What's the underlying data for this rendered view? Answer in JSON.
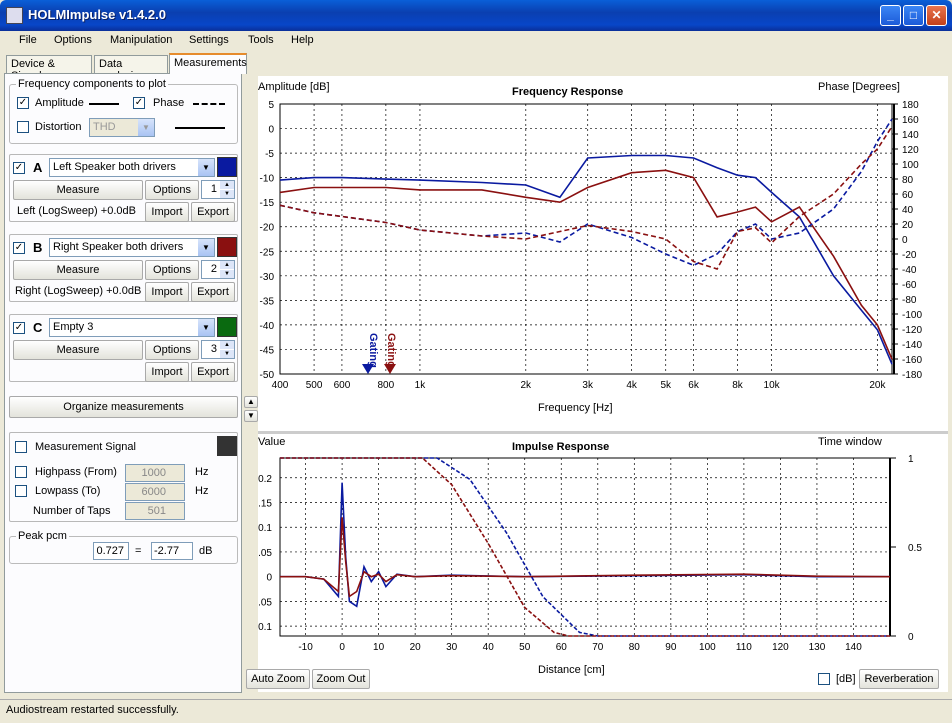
{
  "window": {
    "title": "HOLMImpulse  v1.4.2.0",
    "minimize": "_",
    "maximize": "□",
    "close": "✕"
  },
  "menu": [
    "File",
    "Options",
    "Manipulation",
    "Settings",
    "Tools",
    "Help"
  ],
  "tabs": [
    "Device & Signal",
    "Data analysis",
    "Measurements"
  ],
  "freq_group": {
    "legend": "Frequency components to plot",
    "amplitude": "Amplitude",
    "phase": "Phase",
    "distortion": "Distortion",
    "distortion_select": "THD"
  },
  "measurements": [
    {
      "letter": "A",
      "name": "Left Speaker both drivers",
      "color": "#0a1aa0",
      "measure": "Measure",
      "options": "Options",
      "number": "1",
      "info": "Left (LogSweep) +0.0dB",
      "import": "Import",
      "export": "Export"
    },
    {
      "letter": "B",
      "name": "Right Speaker both drivers",
      "color": "#8a1010",
      "measure": "Measure",
      "options": "Options",
      "number": "2",
      "info": "Right (LogSweep) +0.0dB",
      "import": "Import",
      "export": "Export"
    },
    {
      "letter": "C",
      "name": "Empty 3",
      "color": "#0a6a10",
      "measure": "Measure",
      "options": "Options",
      "number": "3",
      "info": "",
      "import": "Import",
      "export": "Export"
    }
  ],
  "organize": "Organize measurements",
  "signal": {
    "label": "Measurement Signal",
    "highpass": "Highpass (From)",
    "highpass_val": "1000",
    "lowpass": "Lowpass (To)",
    "lowpass_val": "6000",
    "hz": "Hz",
    "taps": "Number of Taps",
    "taps_val": "501"
  },
  "peak": {
    "legend": "Peak pcm",
    "value": "0.727",
    "eq": "=",
    "db": "-2.77",
    "unit": "dB"
  },
  "freq_chart": {
    "title": "Frequency Response",
    "left_label": "Amplitude [dB]",
    "right_label": "Phase [Degrees]",
    "xlabel": "Frequency [Hz]",
    "gating_a": "Gating",
    "gating_b": "Gating",
    "y_ticks": [
      "5",
      "0",
      "-5",
      "-10",
      "-15",
      "-20",
      "-25",
      "-30",
      "-35",
      "-40",
      "-45",
      "-50"
    ],
    "phase_ticks": [
      "180",
      "160",
      "140",
      "120",
      "100",
      "80",
      "60",
      "40",
      "20",
      "0",
      "-20",
      "-40",
      "-60",
      "-80",
      "-100",
      "-120",
      "-140",
      "-160",
      "-180"
    ],
    "x_ticks": [
      "400",
      "500",
      "600",
      "800",
      "1k",
      "2k",
      "3k",
      "4k",
      "5k",
      "6k",
      "8k",
      "10k",
      "20k"
    ]
  },
  "imp_chart": {
    "title": "Impulse Response",
    "left_label": "Value",
    "right_label": "Time window",
    "xlabel": "Distance [cm]",
    "y_ticks": [
      "0.2",
      "0.15",
      "0.1",
      "0.05",
      "0",
      "-0.05",
      "-0.1"
    ],
    "win_ticks": [
      "1",
      "0.5",
      "0"
    ],
    "x_ticks": [
      "-10",
      "0",
      "10",
      "20",
      "30",
      "40",
      "50",
      "60",
      "70",
      "80",
      "90",
      "100",
      "110",
      "120",
      "130",
      "140"
    ]
  },
  "chart_data": [
    {
      "type": "line",
      "title": "Frequency Response",
      "xlabel": "Frequency [Hz]",
      "ylabel": "Amplitude [dB]",
      "y2label": "Phase [Degrees]",
      "xscale": "log",
      "xlim": [
        400,
        22000
      ],
      "ylim": [
        -50,
        5
      ],
      "y2lim": [
        -180,
        180
      ],
      "grid": true,
      "x": [
        400,
        500,
        600,
        800,
        1000,
        1500,
        2000,
        2500,
        3000,
        4000,
        5000,
        6000,
        7000,
        8000,
        9000,
        10000,
        12000,
        15000,
        18000,
        20000,
        22000
      ],
      "series": [
        {
          "name": "A amplitude",
          "color": "#0a1aa0",
          "style": "solid",
          "axis": "left",
          "values": [
            -10.5,
            -10,
            -10,
            -10.3,
            -10.5,
            -11,
            -11.5,
            -14,
            -6,
            -5.5,
            -5.5,
            -6,
            -8,
            -9.5,
            -10,
            -13,
            -18,
            -30,
            -37,
            -41,
            -48
          ]
        },
        {
          "name": "B amplitude",
          "color": "#8a1010",
          "style": "solid",
          "axis": "left",
          "values": [
            -13,
            -12,
            -12,
            -12,
            -12.5,
            -12.5,
            -14,
            -15,
            -12,
            -9,
            -8.5,
            -10,
            -18,
            -17,
            -16,
            -19,
            -16,
            -26,
            -36,
            -40,
            -47
          ]
        },
        {
          "name": "A phase",
          "color": "#0a1aa0",
          "style": "dash",
          "axis": "right",
          "values": [
            45,
            35,
            30,
            22,
            12,
            4,
            8,
            -4,
            20,
            2,
            -20,
            -35,
            -20,
            10,
            20,
            0,
            8,
            40,
            90,
            130,
            160
          ]
        },
        {
          "name": "B phase",
          "color": "#8a1010",
          "style": "dash",
          "axis": "right",
          "values": [
            45,
            35,
            30,
            22,
            12,
            4,
            0,
            10,
            18,
            10,
            0,
            -30,
            -40,
            10,
            15,
            -5,
            30,
            60,
            100,
            120,
            150
          ]
        }
      ]
    },
    {
      "type": "line",
      "title": "Impulse Response",
      "xlabel": "Distance [cm]",
      "ylabel": "Value",
      "y2label": "Time window",
      "xlim": [
        -17,
        150
      ],
      "ylim": [
        -0.12,
        0.24
      ],
      "y2lim": [
        0,
        1
      ],
      "grid": true,
      "x": [
        -17,
        -10,
        -5,
        -1,
        0,
        1,
        2,
        4,
        6,
        8,
        10,
        12,
        15,
        20,
        30,
        50,
        80,
        110,
        130,
        150
      ],
      "series": [
        {
          "name": "A impulse",
          "color": "#0a1aa0",
          "style": "solid",
          "axis": "left",
          "values": [
            0,
            0,
            -0.005,
            -0.04,
            0.19,
            0.04,
            -0.05,
            -0.06,
            0.02,
            -0.01,
            0.01,
            -0.02,
            0.005,
            0,
            0.003,
            0,
            0.002,
            0.004,
            0,
            0
          ]
        },
        {
          "name": "B impulse",
          "color": "#8a1010",
          "style": "solid",
          "axis": "left",
          "values": [
            0,
            0,
            -0.005,
            -0.03,
            0.12,
            0.03,
            -0.04,
            -0.03,
            0.01,
            0.0,
            0.005,
            -0.01,
            0.004,
            0,
            0.002,
            0,
            0.003,
            0.005,
            0.001,
            0
          ]
        },
        {
          "name": "A window",
          "color": "#0a1aa0",
          "style": "dash",
          "axis": "right",
          "x": [
            -17,
            26,
            35,
            45,
            55,
            65,
            70,
            150
          ],
          "values": [
            1,
            1,
            0.88,
            0.58,
            0.22,
            0.02,
            0,
            0
          ]
        },
        {
          "name": "B window",
          "color": "#8a1010",
          "style": "dash",
          "axis": "right",
          "x": [
            -17,
            22,
            30,
            40,
            50,
            58,
            62,
            150
          ],
          "values": [
            1,
            1,
            0.85,
            0.52,
            0.16,
            0.02,
            0,
            0
          ]
        }
      ]
    }
  ],
  "buttons": {
    "autozoom": "Auto Zoom",
    "zoomout": "Zoom Out",
    "db": "[dB]",
    "reverb": "Reverberation"
  },
  "status": "Audiostream restarted successfully."
}
